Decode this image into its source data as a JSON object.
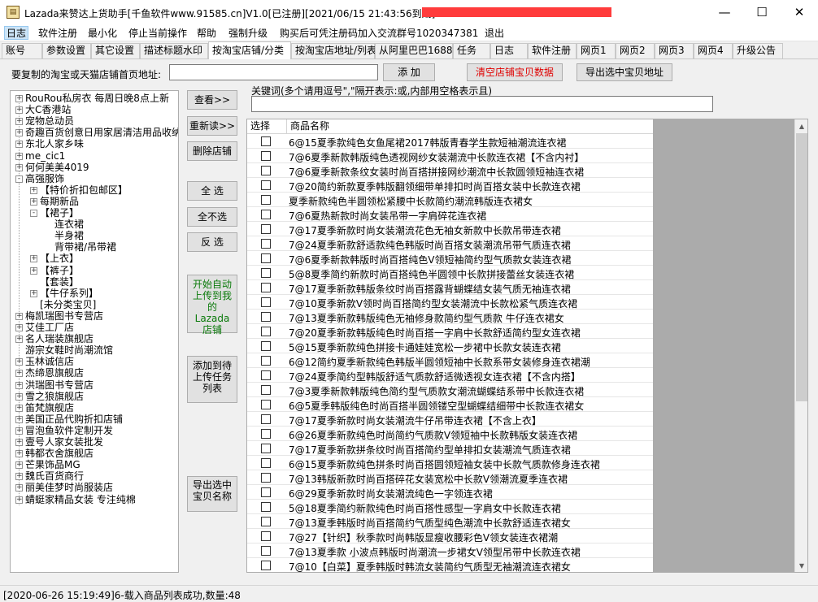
{
  "window": {
    "title": "Lazada来赞达上货助手[千鱼软件www.91585.cn]V1.0[已注册][2021/06/15 21:43:56到期]-",
    "icon": "app-clipboard-icon",
    "minimize": "—",
    "maximize": "☐",
    "close": "✕"
  },
  "menu": [
    "日志",
    "软件注册",
    "最小化",
    "停止当前操作",
    "帮助",
    "强制升级",
    "购买后可凭注册码加入交流群号1020347381",
    "退出"
  ],
  "tabs": [
    "账号",
    "参数设置",
    "其它设置",
    "描述标题水印",
    "按淘宝店铺/分类",
    "按淘宝店地址/列表",
    "从阿里巴巴1688",
    "任务",
    "日志",
    "软件注册",
    "网页1",
    "网页2",
    "网页3",
    "网页4",
    "升级公告"
  ],
  "url_row": {
    "label": "要复制的淘宝或天猫店铺首页地址:",
    "value": "",
    "add_button": "添  加",
    "clear_button": "清空店铺宝贝数据",
    "export_button": "导出选中宝贝地址"
  },
  "keyword": {
    "label": "关键词(多个请用逗号\",\"隔开表示:或,内部用空格表示且)",
    "value": ""
  },
  "tree": [
    {
      "text": "RouRou私房衣 每周日晚8点上新",
      "level": 0,
      "toggle": "+"
    },
    {
      "text": "大C香港站",
      "level": 0,
      "toggle": "+"
    },
    {
      "text": "宠物总动员",
      "level": 0,
      "toggle": "+"
    },
    {
      "text": "奇趣百货创意日用家居清洁用品收纳",
      "level": 0,
      "toggle": "+"
    },
    {
      "text": "东北人家乡味",
      "level": 0,
      "toggle": "+"
    },
    {
      "text": "me_cic1",
      "level": 0,
      "toggle": "+"
    },
    {
      "text": "何何美美4019",
      "level": 0,
      "toggle": "+"
    },
    {
      "text": "高强服饰",
      "level": 0,
      "toggle": "-"
    },
    {
      "text": "【特价折扣包邮区】",
      "level": 1,
      "toggle": "+"
    },
    {
      "text": "每期新品",
      "level": 1,
      "toggle": "+"
    },
    {
      "text": "【裙子】",
      "level": 1,
      "toggle": "-"
    },
    {
      "text": "连衣裙",
      "level": 2,
      "toggle": ""
    },
    {
      "text": "半身裙",
      "level": 2,
      "toggle": ""
    },
    {
      "text": "背带裙/吊带裙",
      "level": 2,
      "toggle": ""
    },
    {
      "text": "【上衣】",
      "level": 1,
      "toggle": "+"
    },
    {
      "text": "【裤子】",
      "level": 1,
      "toggle": "+"
    },
    {
      "text": "【套装】",
      "level": 1,
      "toggle": ""
    },
    {
      "text": "【牛仔系列】",
      "level": 1,
      "toggle": "+"
    },
    {
      "text": "[未分类宝贝]",
      "level": 1,
      "toggle": ""
    },
    {
      "text": "梅凯瑞图书专营店",
      "level": 0,
      "toggle": "+"
    },
    {
      "text": "艾佳工厂店",
      "level": 0,
      "toggle": "+"
    },
    {
      "text": "名人瑞装旗舰店",
      "level": 0,
      "toggle": "+"
    },
    {
      "text": "游宗女鞋时尚潮流馆",
      "level": 0,
      "toggle": ""
    },
    {
      "text": "玉林诚信店",
      "level": 0,
      "toggle": "+"
    },
    {
      "text": "杰缔恩旗舰店",
      "level": 0,
      "toggle": "+"
    },
    {
      "text": "洪瑞图书专营店",
      "level": 0,
      "toggle": "+"
    },
    {
      "text": "雪之狼旗舰店",
      "level": 0,
      "toggle": "+"
    },
    {
      "text": "笛梵旗舰店",
      "level": 0,
      "toggle": "+"
    },
    {
      "text": "美国正品代购折扣店铺",
      "level": 0,
      "toggle": "+"
    },
    {
      "text": "冒泡鱼软件定制开发",
      "level": 0,
      "toggle": "+"
    },
    {
      "text": "壹号人家女装批发",
      "level": 0,
      "toggle": "+"
    },
    {
      "text": "韩都衣舍旗舰店",
      "level": 0,
      "toggle": "+"
    },
    {
      "text": "芒果饰品MG",
      "level": 0,
      "toggle": "+"
    },
    {
      "text": "魏氏百货商行",
      "level": 0,
      "toggle": "+"
    },
    {
      "text": "丽美佳梦时尚服装店",
      "level": 0,
      "toggle": "+"
    },
    {
      "text": "蜻蜓家精品女装 专注纯棉",
      "level": 0,
      "toggle": "+"
    }
  ],
  "side_buttons": {
    "view": "查看>>",
    "reload": "重新读>>",
    "delete_shop": "删除店铺",
    "select_all": "全  选",
    "select_none": "全不选",
    "invert": "反  选",
    "auto_upload": "开始自动上传到我的Lazada店铺",
    "add_task": "添加到待上传任务列表",
    "export_names": "导出选中宝贝名称"
  },
  "table": {
    "col_select": "选择",
    "col_name": "商品名称",
    "rows": [
      "6@15夏季款纯色女鱼尾裙2017韩版青春学生款短袖潮流连衣裙",
      "7@6夏季新款韩版纯色透视网纱女装潮流中长款连衣裙【不含内衬】",
      "7@6夏季新款条纹女装时尚百搭拼接网纱潮流中长款圆领短袖连衣裙",
      "7@20简约新款夏季韩版翻领细带单排扣时尚百搭女装中长款连衣裙",
      "夏季新款纯色半圆领松紧腰中长款简约潮流韩版连衣裙女",
      "7@6夏热新款时尚女装吊带一字肩碎花连衣裙",
      "7@17夏季新款时尚女装潮流花色无袖女新款中长款吊带连衣裙",
      "7@24夏季新款舒适款纯色韩版时尚百搭女装潮流吊带气质连衣裙",
      "7@6夏季新款韩版时尚百搭纯色V领短袖简约型气质款女装连衣裙",
      "5@8夏季简约新款时尚百搭纯色半圆领中长款拼接蕾丝女装连衣裙",
      "7@17夏季新款韩版条纹时尚百搭露背蝴蝶结女装气质无袖连衣裙",
      "7@10夏季新款V领时尚百搭简约型女装潮流中长款松紧气质连衣裙",
      "7@13夏季新款韩版纯色无袖修身款简约型气质款 牛仔连衣裙女",
      "7@20夏季新款韩版纯色时尚百搭一字肩中长款舒适简约型女连衣裙",
      "5@15夏季新款纯色拼接卡通娃娃宽松一步裙中长款女装连衣裙",
      "6@12简约夏季新款纯色韩版半圆领短袖中长款系带女装修身连衣裙潮",
      "7@24夏季简约型韩版舒适气质款舒适微透视女连衣裙【不含内搭】",
      "7@3夏季新款韩版纯色简约型气质款女潮流蝴蝶结系带中长款连衣裙",
      "6@5夏季韩版纯色时尚百搭半圆领镂空型蝴蝶结细带中长款连衣裙女",
      "7@17夏季新款时尚女装潮流牛仔吊带连衣裙【不含上衣】",
      "6@26夏季新款纯色时尚简约气质款V领短袖中长款韩版女装连衣裙",
      "7@17夏季新款拼条纹时尚百搭简约型单排扣女装潮流气质连衣裙",
      "6@15夏季新款纯色拼条时尚百搭圆领短袖女装中长款气质款修身连衣裙",
      "7@13韩版新款时尚百搭碎花女装宽松中长款V领潮流夏季连衣裙",
      "6@29夏季新款时尚女装潮流纯色一字领连衣裙",
      "5@18夏季简约新款纯色时尚百搭性感型一字肩女中长款连衣裙",
      "7@13夏季韩版时尚百搭简约气质型纯色潮流中长款舒适连衣裙女",
      "7@27【针织】秋季款时尚韩版显瘦收腰彩色V领女装连衣裙潮",
      "7@13夏季款 小波点韩版时尚潮流一步裙女V领型吊带中长款连衣裙",
      "7@10【白菜】夏季韩版时韩流女装简约气质型无袖潮流连衣裙女"
    ]
  },
  "status": "[2020-06-26 15:19:49]6-载入商品列表成功,数量:48"
}
